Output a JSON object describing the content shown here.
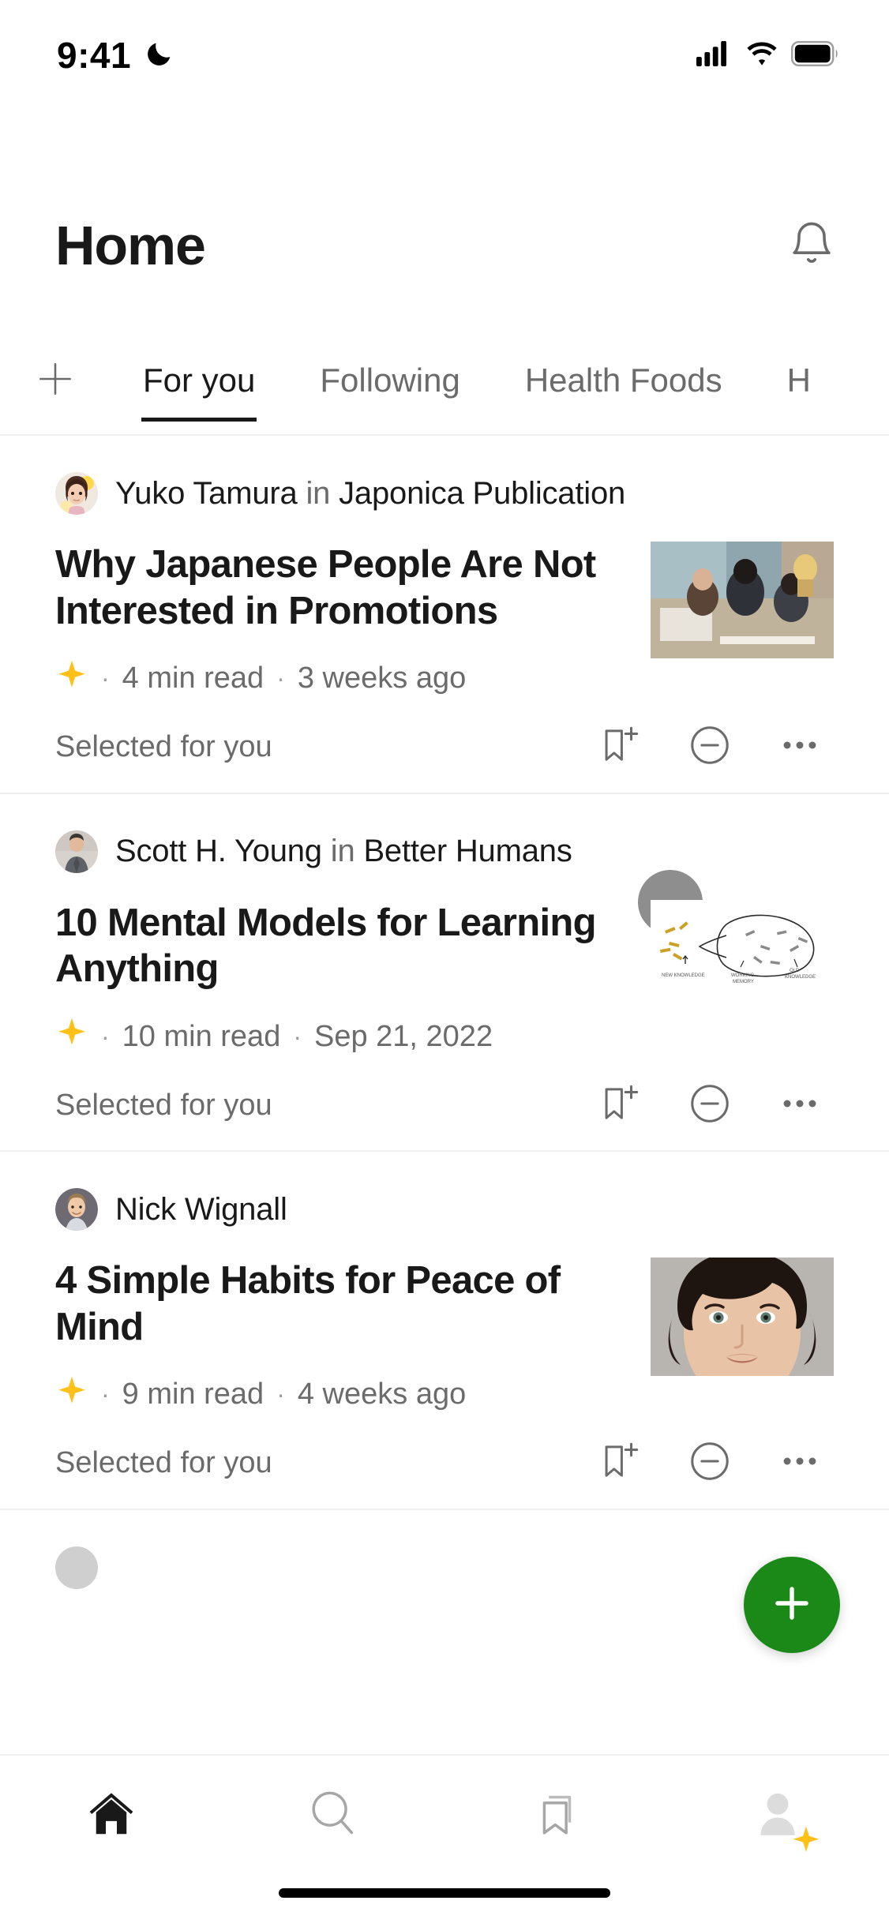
{
  "status_bar": {
    "time": "9:41",
    "dnd_icon": "crescent-moon-icon",
    "signal_icon": "cellular-signal-icon",
    "wifi_icon": "wifi-icon",
    "battery_icon": "battery-full-icon"
  },
  "header": {
    "title": "Home",
    "notifications_icon": "bell-icon"
  },
  "tabs": {
    "add_icon": "plus-icon",
    "items": [
      {
        "label": "For you",
        "active": true
      },
      {
        "label": "Following",
        "active": false
      },
      {
        "label": "Health Foods",
        "active": false
      },
      {
        "label": "H",
        "active": false
      }
    ]
  },
  "feed": {
    "articles": [
      {
        "author": "Yuko Tamura",
        "in_word": "in",
        "publication": "Japonica Publication",
        "title": "Why Japanese People Are Not Interested in Promotions",
        "member_icon": "star-sparkle-icon",
        "read_time": "4  min read",
        "date": "3 weeks ago",
        "selected_label": "Selected for you",
        "bookmark_icon": "bookmark-plus-icon",
        "hide_icon": "circle-minus-icon",
        "more_icon": "more-dots-icon"
      },
      {
        "author": "Scott H. Young",
        "in_word": "in",
        "publication": "Better Humans",
        "title": "10 Mental Models for Learning Anything",
        "member_icon": "star-sparkle-icon",
        "read_time": "10  min read",
        "date": "Sep 21, 2022",
        "selected_label": "Selected for you",
        "bookmark_icon": "bookmark-plus-icon",
        "hide_icon": "circle-minus-icon",
        "more_icon": "more-dots-icon"
      },
      {
        "author": "Nick Wignall",
        "in_word": "",
        "publication": "",
        "title": "4 Simple Habits for Peace of Mind",
        "member_icon": "star-sparkle-icon",
        "read_time": "9  min read",
        "date": "4 weeks ago",
        "selected_label": "Selected for you",
        "bookmark_icon": "bookmark-plus-icon",
        "hide_icon": "circle-minus-icon",
        "more_icon": "more-dots-icon"
      }
    ]
  },
  "fab": {
    "icon": "plus-icon",
    "color": "#1A8917"
  },
  "bottom_nav": {
    "items": [
      {
        "icon": "home-icon",
        "active": true
      },
      {
        "icon": "search-icon",
        "active": false
      },
      {
        "icon": "bookmark-icon",
        "active": false
      },
      {
        "icon": "profile-icon",
        "active": false
      }
    ]
  },
  "colors": {
    "accent_green": "#1A8917",
    "star_gold": "#FFC017",
    "text_primary": "#191919",
    "text_secondary": "#6B6B6B"
  }
}
